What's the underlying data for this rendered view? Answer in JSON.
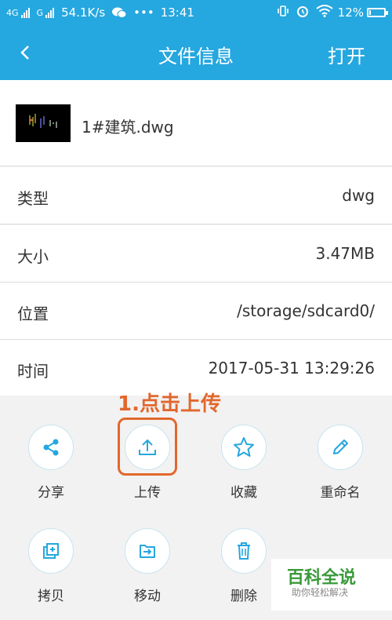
{
  "status_bar": {
    "network1": "4G",
    "network2": "G",
    "speed": "54.1K/s",
    "dots": "•••",
    "time": "13:41",
    "battery": "12%",
    "battery_level": 0.12
  },
  "header": {
    "title": "文件信息",
    "open_label": "打开"
  },
  "file": {
    "name": "1#建筑.dwg"
  },
  "info": [
    {
      "label": "类型",
      "value": "dwg"
    },
    {
      "label": "大小",
      "value": "3.47MB"
    },
    {
      "label": "位置",
      "value": "/storage/sdcard0/"
    },
    {
      "label": "时间",
      "value": "2017-05-31 13:29:26"
    }
  ],
  "annotation": "1.点击上传",
  "actions": [
    {
      "label": "分享",
      "icon": "share-icon"
    },
    {
      "label": "上传",
      "icon": "upload-icon"
    },
    {
      "label": "收藏",
      "icon": "star-icon"
    },
    {
      "label": "重命名",
      "icon": "pencil-icon"
    },
    {
      "label": "拷贝",
      "icon": "copy-icon"
    },
    {
      "label": "移动",
      "icon": "move-icon"
    },
    {
      "label": "删除",
      "icon": "trash-icon"
    }
  ],
  "watermark": {
    "title": "百科全说",
    "subtitle": "助你轻松解决"
  },
  "colors": {
    "accent": "#25a7df",
    "highlight": "#e2672d"
  }
}
